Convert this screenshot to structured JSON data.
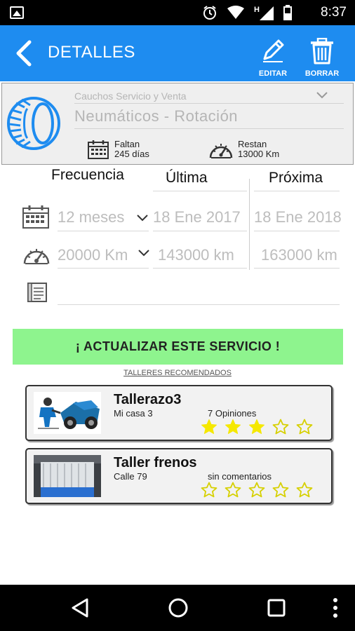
{
  "status_bar": {
    "time": "8:37",
    "icons": [
      "image-icon",
      "alarm-icon",
      "wifi-icon",
      "h-signal-icon",
      "cell-signal-icon",
      "battery-icon"
    ]
  },
  "app_bar": {
    "title": "DETALLES",
    "edit_label": "EDITAR",
    "delete_label": "BORRAR",
    "color": "#1e8cf0"
  },
  "service": {
    "category": "Cauchos Servicio y Venta",
    "name": "Neumáticos - Rotación",
    "remaining_days_label": "Faltan",
    "remaining_days_value": "245 días",
    "remaining_km_label": "Restan",
    "remaining_km_value": "13000 Km"
  },
  "table": {
    "headers": {
      "frequency": "Frecuencia",
      "last": "Última",
      "next": "Próxima"
    },
    "time_row": {
      "frequency": "12 meses",
      "last": "18 Ene 2017",
      "next": "18 Ene 2018"
    },
    "km_row": {
      "frequency": "20000 Km",
      "last": "143000 km",
      "next": "163000 km"
    },
    "notes": ""
  },
  "update_button": {
    "label": "¡ ACTUALIZAR ESTE SERVICIO !",
    "color": "#8ef48e"
  },
  "recommended": {
    "label": "TALLERES RECOMENDADOS",
    "shops": [
      {
        "name": "Tallerazo3",
        "address": "Mi casa 3",
        "opinions": "7 Opiniones",
        "rating": 3,
        "max_rating": 5
      },
      {
        "name": "Taller frenos",
        "address": "Calle 79",
        "opinions": "sin comentarios",
        "rating": 0,
        "max_rating": 5
      }
    ]
  },
  "colors": {
    "star": "#f5e800",
    "star_outline": "#d6d000"
  }
}
